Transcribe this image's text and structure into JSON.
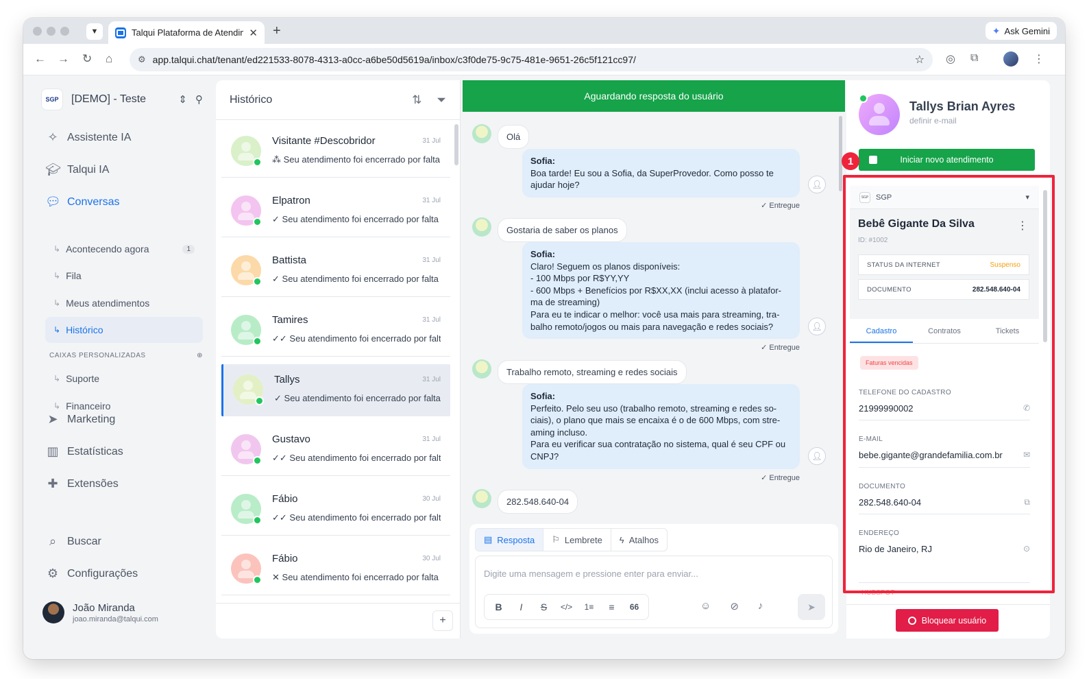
{
  "browser": {
    "tab_title": "Talqui Plataforma de Atendim",
    "tab_close": "✕",
    "new_tab": "+",
    "url": "app.talqui.chat/tenant/ed221533-8078-4313-a0cc-a6be50d5619a/inbox/c3f0de75-9c75-481e-9651-26c5f121cc97/",
    "ask_gemini": "Ask Gemini"
  },
  "sidebar": {
    "org_logo": "SGP",
    "org_name": "[DEMO] - Teste",
    "main_items": [
      {
        "label": "Assistente IA",
        "icon": "sparkle-icon"
      },
      {
        "label": "Talqui IA",
        "icon": "graduation-cap-icon"
      },
      {
        "label": "Conversas",
        "icon": "chat-bubbles-icon"
      }
    ],
    "sub_items": [
      {
        "label": "Acontecendo agora",
        "badge": "1"
      },
      {
        "label": "Fila",
        "badge": ""
      },
      {
        "label": "Meus atendimentos",
        "badge": ""
      },
      {
        "label": "Histórico",
        "badge": ""
      }
    ],
    "section_label": "CAIXAS PERSONALIZADAS",
    "custom_items": [
      {
        "label": "Suporte"
      },
      {
        "label": "Financeiro"
      }
    ],
    "lower_items": [
      {
        "label": "Marketing",
        "icon": "send-icon"
      },
      {
        "label": "Estatísticas",
        "icon": "bar-chart-icon"
      },
      {
        "label": "Extensões",
        "icon": "puzzle-icon"
      }
    ],
    "bottom_items": [
      {
        "label": "Buscar",
        "icon": "search-icon"
      },
      {
        "label": "Configurações",
        "icon": "gear-icon"
      }
    ],
    "user": {
      "name": "João Miranda",
      "email": "joao.miranda@talqui.com"
    }
  },
  "conversation_list": {
    "title": "Histórico",
    "items": [
      {
        "name": "Visitante #Descobridor",
        "date": "31 Jul",
        "status_icon": "⁂",
        "preview": "Seu atendimento foi encerrado por falta de resposta",
        "avatar_color": "#d9f0c9"
      },
      {
        "name": "Elpatron",
        "date": "31 Jul",
        "status_icon": "✓",
        "preview": "Seu atendimento foi encerrado por falta de resposta",
        "avatar_color": "#f3c4ef"
      },
      {
        "name": "Battista",
        "date": "31 Jul",
        "status_icon": "✓",
        "preview": "Seu atendimento foi encerrado por falta de resposta",
        "avatar_color": "#fcd9a8"
      },
      {
        "name": "Tamires",
        "date": "31 Jul",
        "status_icon": "✓✓",
        "preview": "Seu atendimento foi encerrado por falta de resposta",
        "avatar_color": "#b7ecc7"
      },
      {
        "name": "Tallys",
        "date": "31 Jul",
        "status_icon": "✓",
        "preview": "Seu atendimento foi encerrado por falta de resposta",
        "avatar_color": "#e3f0c6"
      },
      {
        "name": "Gustavo",
        "date": "31 Jul",
        "status_icon": "✓✓",
        "preview": "Seu atendimento foi encerrado por falta de resposta",
        "avatar_color": "#f1c6ee"
      },
      {
        "name": "Fábio",
        "date": "30 Jul",
        "status_icon": "✓✓",
        "preview": "Seu atendimento foi encerrado por falta de resposta",
        "avatar_color": "#b9ecc8"
      },
      {
        "name": "Fábio",
        "date": "30 Jul",
        "status_icon": "✕",
        "preview": "Seu atendimento foi encerrado por falta de resposta",
        "avatar_color": "#fbc3bc"
      }
    ],
    "add_label": "+"
  },
  "chat": {
    "banner": "Aguardando resposta do usuário",
    "messages": [
      {
        "text": "Olá"
      },
      {
        "sender": "Sofia:",
        "text": "Boa tarde! Eu sou a Sofia, da SuperProvedor. Como posso te ajudar hoje?",
        "status": "✓ Entregue"
      },
      {
        "text": "Gostaria de saber os planos"
      },
      {
        "sender": "Sofia:",
        "text": "Claro! Seguem os planos disponíveis:\n- 100 Mbps por R$YY,YY\n- 600 Mbps + Benefícios por R$XX,XX (inclui acesso à platafor-ma de streaming)\nPara eu te indicar o melhor: você usa mais para streaming, tra-balho remoto/jogos ou mais para navegação e redes sociais?",
        "status": "✓ Entregue"
      },
      {
        "text": "Trabalho remoto, streaming e redes sociais"
      },
      {
        "sender": "Sofia:",
        "text": "Perfeito. Pelo seu uso (trabalho remoto, streaming e redes so-ciais), o plano que mais se encaixa é o de 600 Mbps, com stre-aming incluso.\nPara eu verificar sua contratação no sistema, qual é seu CPF ou CNPJ?",
        "status": "✓ Entregue"
      },
      {
        "text": "282.548.640-04"
      }
    ],
    "composer": {
      "tabs": [
        "Resposta",
        "Lembrete",
        "Atalhos"
      ],
      "placeholder": "Digite uma mensagem e pressione enter para enviar...",
      "format_buttons": [
        "B",
        "I",
        "S",
        "</>",
        "1≡",
        "≡",
        "66"
      ]
    }
  },
  "contact": {
    "name": "Tallys Brian Ayres",
    "email_placeholder": "definir e-mail",
    "start_button": "Iniciar novo atendimento",
    "integration": {
      "name": "SGP",
      "client_name": "Bebê Gigante Da Silva",
      "client_id": "ID: #1002",
      "internet_status_label": "STATUS DA INTERNET",
      "internet_status_value": "Suspenso",
      "document_label": "DOCUMENTO",
      "document_value": "282.548.640-04",
      "tabs": [
        "Cadastro",
        "Contratos",
        "Tickets"
      ],
      "tag": "Faturas vencidas",
      "fields": [
        {
          "label": "TELEFONE DO CADASTRO",
          "value": "21999990002",
          "icon": "phone-icon"
        },
        {
          "label": "E-MAIL",
          "value": "bebe.gigante@grandefamilia.com.br",
          "icon": "mail-icon"
        },
        {
          "label": "DOCUMENTO",
          "value": "282.548.640-04",
          "icon": "copy-icon"
        },
        {
          "label": "ENDEREÇO",
          "value": "Rio de Janeiro, RJ",
          "icon": "map-pin-icon"
        }
      ]
    },
    "next_integration": "HUBSPOT",
    "block_button": "Bloquear usuário"
  },
  "annotation": {
    "marker": "1",
    "color": "#ef233c"
  }
}
